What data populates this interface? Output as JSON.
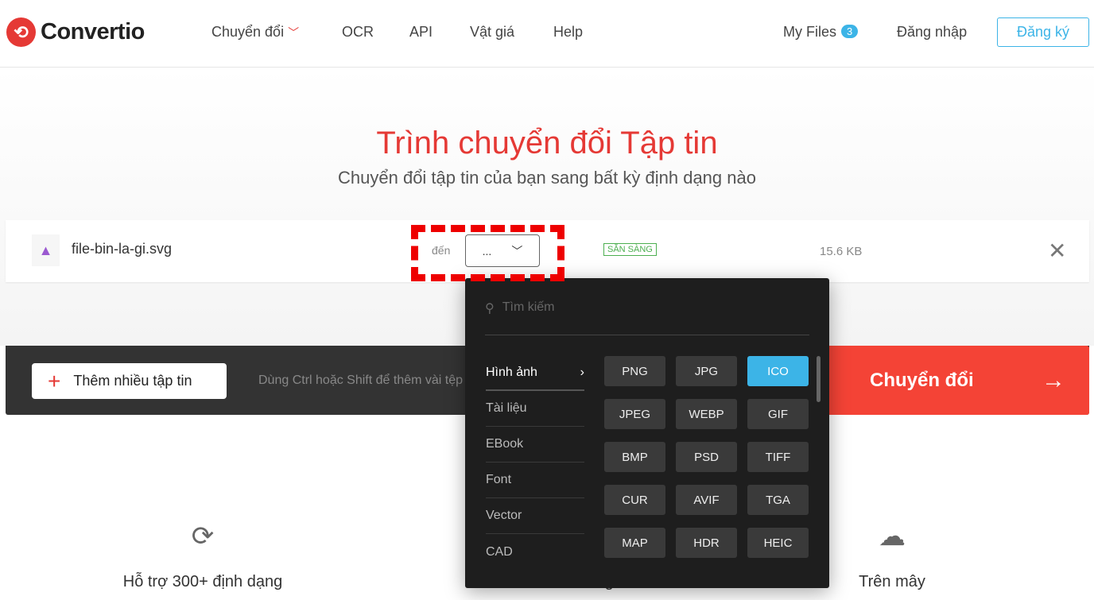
{
  "header": {
    "logo": "Convertio",
    "nav": [
      "Chuyển đổi",
      "OCR",
      "API",
      "Vật giá",
      "Help"
    ],
    "my_files": "My Files",
    "my_files_count": "3",
    "login": "Đăng nhập",
    "signup": "Đăng ký"
  },
  "hero": {
    "title": "Trình chuyển đổi Tập tin",
    "subtitle": "Chuyển đổi tập tin của bạn sang bất kỳ định dạng nào"
  },
  "file": {
    "name": "file-bin-la-gi.svg",
    "to_label": "đến",
    "selected": "...",
    "status": "SẴN SÀNG",
    "size": "15.6 KB"
  },
  "toolbar": {
    "add_label": "Thêm nhiều tập tin",
    "hint": "Dùng Ctrl hoặc Shift để thêm vài tệp",
    "convert_label": "Chuyển đổi"
  },
  "dropdown": {
    "search_placeholder": "Tìm kiếm",
    "categories": [
      "Hình ảnh",
      "Tài liệu",
      "EBook",
      "Font",
      "Vector",
      "CAD"
    ],
    "active_category": "Hình ảnh",
    "formats": [
      "PNG",
      "JPG",
      "ICO",
      "JPEG",
      "WEBP",
      "GIF",
      "BMP",
      "PSD",
      "TIFF",
      "CUR",
      "AVIF",
      "TGA",
      "MAP",
      "HDR",
      "HEIC"
    ],
    "selected_format": "ICO"
  },
  "features": [
    "Hỗ trợ 300+ định dạng",
    "Nhanh và dễ dàng",
    "Trên mây"
  ],
  "colors": {
    "brand": "#e53935",
    "accent": "#3cb4e7",
    "dropdown_bg": "#1e1e1e"
  }
}
